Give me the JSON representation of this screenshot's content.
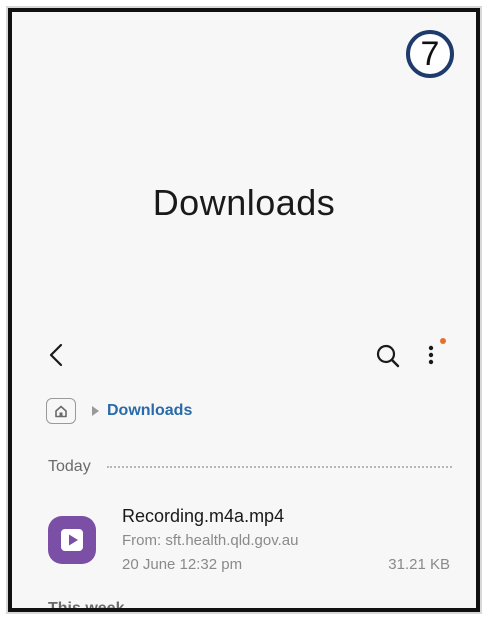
{
  "step_badge": "7",
  "header": {
    "title": "Downloads"
  },
  "toolbar": {
    "back_icon": "chevron-left-icon",
    "search_icon": "search-icon",
    "more_icon": "more-vertical-icon",
    "notification_dot_color": "#e8702a"
  },
  "breadcrumb": {
    "home_icon": "home-folder-icon",
    "current": "Downloads"
  },
  "sections": [
    {
      "label": "Today",
      "files": [
        {
          "name": "Recording.m4a.mp4",
          "source": "From: sft.health.qld.gov.au",
          "date": "20 June 12:32 pm",
          "size": "31.21 KB",
          "icon": "video-play-icon",
          "icon_color": "#7b4fa6"
        }
      ]
    },
    {
      "label": "This week"
    }
  ],
  "colors": {
    "accent": "#2a6aa8",
    "badge_border": "#1f3b6b"
  }
}
